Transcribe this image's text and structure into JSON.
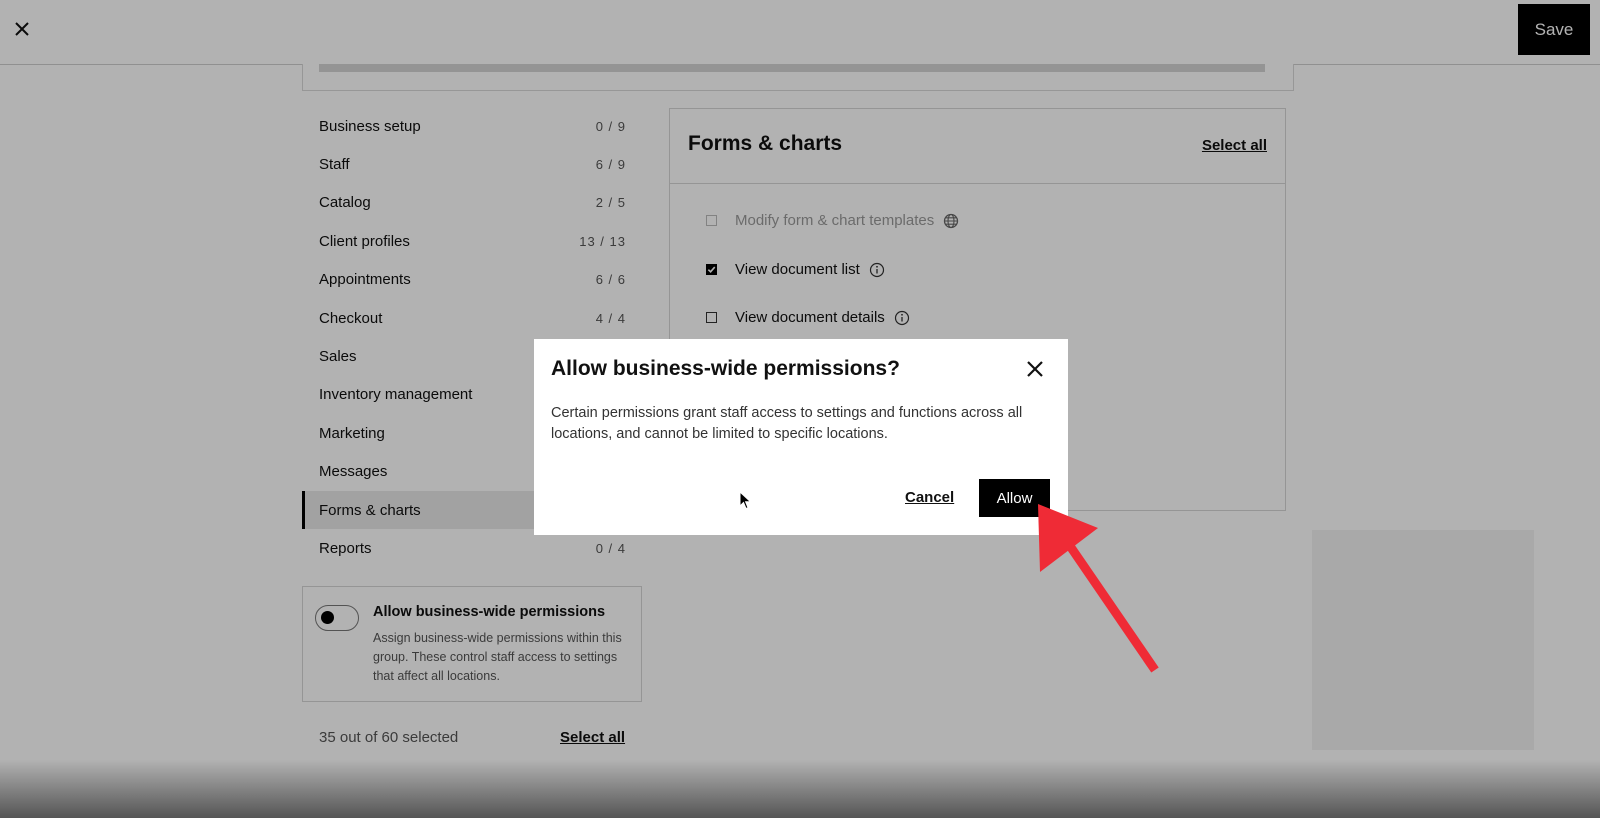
{
  "topbar": {
    "save_label": "Save"
  },
  "nav": {
    "items": [
      {
        "label": "Business setup",
        "count": "0 / 9"
      },
      {
        "label": "Staff",
        "count": "6 / 9"
      },
      {
        "label": "Catalog",
        "count": "2 / 5"
      },
      {
        "label": "Client profiles",
        "count": "13 / 13"
      },
      {
        "label": "Appointments",
        "count": "6 / 6"
      },
      {
        "label": "Checkout",
        "count": "4 / 4"
      },
      {
        "label": "Sales",
        "count": ""
      },
      {
        "label": "Inventory management",
        "count": ""
      },
      {
        "label": "Marketing",
        "count": ""
      },
      {
        "label": "Messages",
        "count": ""
      },
      {
        "label": "Forms & charts",
        "count": ""
      },
      {
        "label": "Reports",
        "count": "0 / 4"
      }
    ],
    "active_item": "Forms & charts"
  },
  "business_wide": {
    "title": "Allow business-wide permissions",
    "description": "Assign business-wide permissions within this group. These control staff access to settings that affect all locations.",
    "enabled": false
  },
  "footer": {
    "selected_text": "35 out of 60 selected",
    "select_all": "Select all"
  },
  "panel": {
    "title": "Forms & charts",
    "select_all": "Select all",
    "permissions": [
      {
        "label": "Modify form & chart templates",
        "checked": false,
        "disabled": true,
        "icon": "globe-icon"
      },
      {
        "label": "View document list",
        "checked": true,
        "disabled": false,
        "icon": "info-icon"
      },
      {
        "label": "View document details",
        "checked": false,
        "disabled": false,
        "icon": "info-icon"
      }
    ]
  },
  "dialog": {
    "title": "Allow business-wide permissions?",
    "body": "Certain permissions grant staff access to settings and functions across all locations, and cannot be limited to specific locations.",
    "cancel_label": "Cancel",
    "allow_label": "Allow"
  },
  "colors": {
    "primary": "#000000",
    "annotation_arrow": "#ef2b36"
  }
}
